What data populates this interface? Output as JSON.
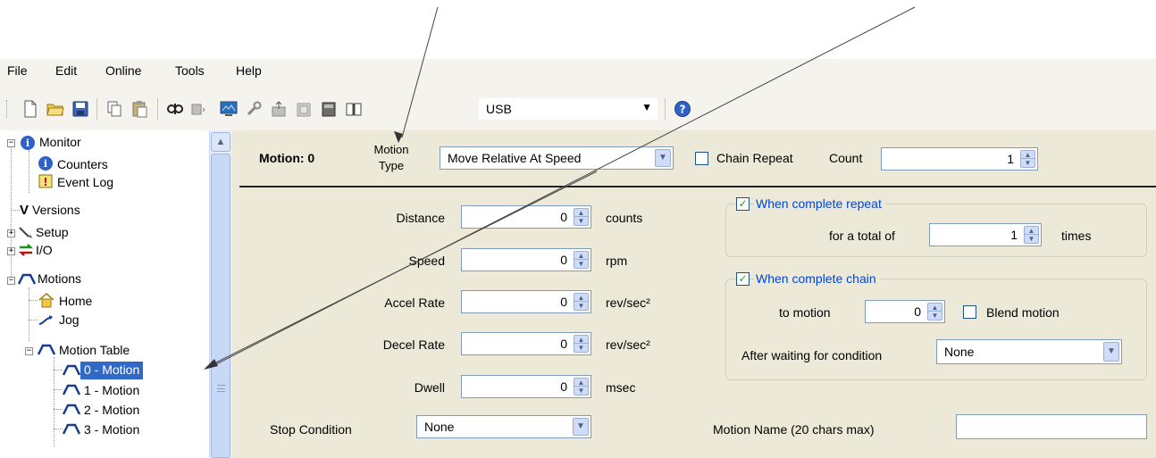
{
  "menu": [
    "File",
    "Edit",
    "Online",
    "Tools",
    "Help"
  ],
  "toolbar": {
    "icons": [
      "new-file-icon",
      "open-folder-icon",
      "save-icon",
      "copy-icon",
      "paste-icon",
      "connect-icon",
      "device-icon",
      "monitor-icon",
      "wrench-icon",
      "upload-icon",
      "download-icon",
      "drive-icon",
      "manual-icon",
      "help-icon"
    ],
    "port": "USB"
  },
  "tree": {
    "items": [
      {
        "label": "Monitor",
        "icon": "info-icon",
        "expander": "−"
      },
      {
        "label": "Counters",
        "icon": "info-icon"
      },
      {
        "label": "Event Log",
        "icon": "event-log-icon"
      },
      {
        "label": "Versions",
        "icon": "versions-icon"
      },
      {
        "label": "Setup",
        "icon": "setup-icon",
        "expander": "+"
      },
      {
        "label": "I/O",
        "icon": "io-icon",
        "expander": "+"
      },
      {
        "label": "Motions",
        "icon": "motion-icon",
        "expander": "−"
      },
      {
        "label": "Home",
        "icon": "home-icon"
      },
      {
        "label": "Jog",
        "icon": "jog-icon"
      },
      {
        "label": "Motion Table",
        "icon": "motion-icon",
        "expander": "−"
      },
      {
        "label": "0 - Motion",
        "icon": "motion-icon",
        "selected": true
      },
      {
        "label": "1 - Motion",
        "icon": "motion-icon"
      },
      {
        "label": "2 - Motion",
        "icon": "motion-icon"
      },
      {
        "label": "3 - Motion",
        "icon": "motion-icon"
      }
    ]
  },
  "header": {
    "motion_title": "Motion: 0",
    "motion_type_label_1": "Motion",
    "motion_type_label_2": "Type",
    "motion_type_value": "Move Relative At Speed",
    "chain_repeat_label": "Chain Repeat",
    "chain_repeat_checked": false,
    "count_label": "Count",
    "count_value": "1"
  },
  "params": [
    {
      "label": "Distance",
      "value": "0",
      "unit": "counts"
    },
    {
      "label": "Speed",
      "value": "0",
      "unit": "rpm"
    },
    {
      "label": "Accel Rate",
      "value": "0",
      "unit": "rev/sec²"
    },
    {
      "label": "Decel Rate",
      "value": "0",
      "unit": "rev/sec²"
    },
    {
      "label": "Dwell",
      "value": "0",
      "unit": "msec"
    }
  ],
  "stop_condition": {
    "label": "Stop Condition",
    "value": "None"
  },
  "repeat_group": {
    "title": "When complete repeat",
    "checked": true,
    "total_label": "for a total of",
    "value": "1",
    "unit": "times"
  },
  "chain_group": {
    "title": "When complete chain",
    "checked": true,
    "to_motion_label": "to motion",
    "to_motion_value": "0",
    "blend_label": "Blend motion",
    "blend_checked": false,
    "wait_label": "After waiting for condition",
    "wait_value": "None"
  },
  "motion_name": {
    "label": "Motion Name (20 chars max)",
    "value": ""
  },
  "colors": {
    "panel": "#ece9d8",
    "selection": "#3169c6",
    "group_title": "#0046d5",
    "check": "#21a121"
  }
}
